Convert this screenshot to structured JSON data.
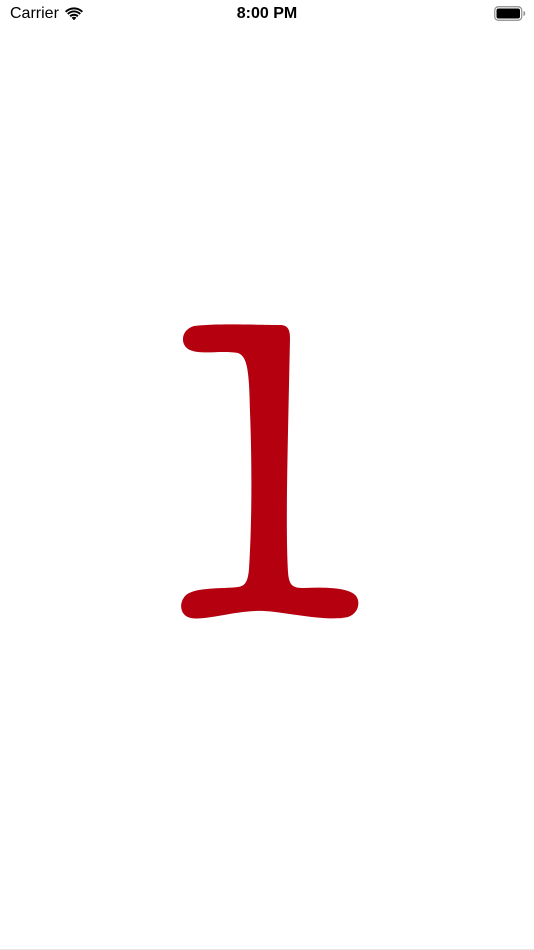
{
  "status_bar": {
    "carrier": "Carrier",
    "time": "8:00 PM",
    "wifi_icon": "wifi-icon",
    "battery_icon": "battery-icon"
  },
  "main": {
    "digit": "1",
    "digit_color": "#b5000f"
  }
}
